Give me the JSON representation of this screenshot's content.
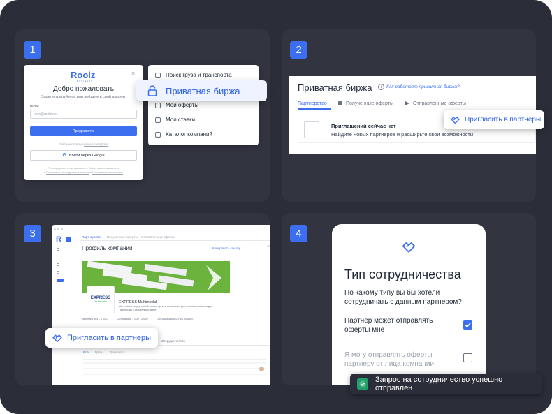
{
  "panels": {
    "p1": {
      "number": "1",
      "login": {
        "logo": "Roolz",
        "logo_sub": "BUSINESS",
        "title": "Добро пожаловать",
        "subtitle": "Зарегистрируйтесь или войдите в свой аккаунт",
        "email_label": "Почта",
        "email_placeholder": "hero@roolz.net",
        "continue_label": "Продолжить",
        "phone_link_prefix": "Войти используя",
        "phone_link": "номер телефона",
        "google_label": "Войти через Google",
        "legal_line1": "Регистрируясь и авторизуясь в Roolz, вы соглашаетесь",
        "legal_and": "с",
        "legal_privacy": "Политикой конфиденциальности",
        "legal_terms": "Условия использования"
      },
      "menu": [
        "Поиск груза и транспорта",
        "Мои оферты",
        "Мои ставки",
        "Каталог компаний"
      ],
      "highlight": "Приватная биржа"
    },
    "p2": {
      "number": "2",
      "title": "Приватная биржа",
      "help_link": "Как работает приватная биржа?",
      "tabs": [
        "Партнерство",
        "Полученные оферты",
        "Отправленные оферты"
      ],
      "empty_title": "Приглашений сейчас нет",
      "empty_text": "Найдите новых партнеров и расширьте свои возможности",
      "invite_label": "Пригласить в партнеры"
    },
    "p3": {
      "number": "3",
      "tabs": [
        "Партнерство",
        "Полученные оферты",
        "Отправленные оферты"
      ],
      "profile_title": "Профиль компании",
      "copy_link": "Копировать ссылку",
      "company_name": "EXPRESS Multimodal",
      "company_desc": "Мы ставим перед собой четкие цели и верим в их достижение любых задач. Перевозки, Таможенный агент",
      "stats": [
        "Автопарк 301 - 1 000",
        "Сотрудники 1 000 - 2 000",
        "Ассоциации ASTRAL MANUT"
      ],
      "section_tabs": [
        "Все",
        "Грузы",
        "Транспорт"
      ],
      "cooperation": "Сотрудничество",
      "invite_label": "Пригласить в партнеры",
      "logo_text": "EXPRESS",
      "logo_sub": "Multimodal"
    },
    "p4": {
      "number": "4",
      "title": "Тип сотрудничества",
      "question": "По какому типу вы бы хотели сотрудничать с данным партнером?",
      "option1": "Партнер может отправлять оферты мне",
      "option2": "Я могу отправлять оферты партнеру от лица компании",
      "toast": "Запрос на сотрудничество успешно отправлен"
    }
  },
  "colors": {
    "background": "#2b2d38",
    "panel": "#323440",
    "accent": "#3b6ff0",
    "accent_light": "#eef3ff",
    "success": "#22a06b",
    "banner_green": "#6cb33e"
  }
}
